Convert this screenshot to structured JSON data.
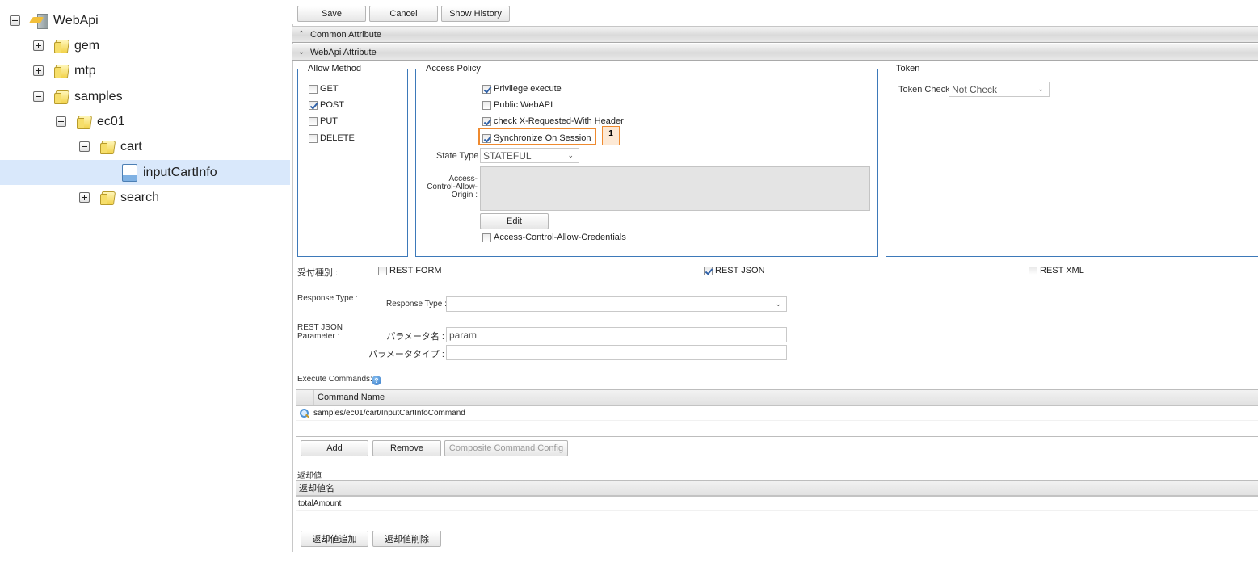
{
  "tree": {
    "nodes": [
      {
        "label": "WebApi",
        "type": "webapi",
        "toggle": "minus"
      },
      {
        "label": "gem",
        "type": "folder",
        "toggle": "plus"
      },
      {
        "label": "mtp",
        "type": "folder",
        "toggle": "plus"
      },
      {
        "label": "samples",
        "type": "folder",
        "toggle": "minus"
      },
      {
        "label": "ec01",
        "type": "folder",
        "toggle": "minus"
      },
      {
        "label": "cart",
        "type": "folder",
        "toggle": "minus"
      },
      {
        "label": "inputCartInfo",
        "type": "file",
        "selected": true
      },
      {
        "label": "search",
        "type": "folder",
        "toggle": "plus"
      }
    ]
  },
  "toolbar": {
    "save_label": "Save",
    "cancel_label": "Cancel",
    "show_history_label": "Show History"
  },
  "sections": {
    "common_attribute": "Common Attribute",
    "webapi_attribute": "WebApi Attribute"
  },
  "allow_method": {
    "legend": "Allow Method",
    "items": [
      {
        "label": "GET",
        "checked": false
      },
      {
        "label": "POST",
        "checked": true
      },
      {
        "label": "PUT",
        "checked": false
      },
      {
        "label": "DELETE",
        "checked": false
      }
    ]
  },
  "access_policy": {
    "legend": "Access Policy",
    "privilege_execute": {
      "label": "Privilege execute",
      "checked": true
    },
    "public_webapi": {
      "label": "Public WebAPI",
      "checked": false
    },
    "check_x_requested": {
      "label": "check X-Requested-With Header",
      "checked": true
    },
    "synchronize_on_session": {
      "label": "Synchronize On Session",
      "checked": true
    },
    "state_type_label": "State Type :",
    "state_type_value": "STATEFUL",
    "acao_label_1": "Access-",
    "acao_label_2": "Control-Allow-",
    "acao_label_3": "Origin :",
    "acao_value": "",
    "edit_label": "Edit",
    "allow_credentials": {
      "label": "Access-Control-Allow-Credentials",
      "checked": false
    }
  },
  "annotation": {
    "badge_label": "1",
    "highlight_color": "#ef8a2f"
  },
  "token": {
    "legend": "Token",
    "token_check_label": "Token Check :",
    "token_check_value": "Not Check"
  },
  "accept_type": {
    "label": "受付種別 :",
    "rest_form": {
      "label": "REST FORM",
      "checked": false
    },
    "rest_json": {
      "label": "REST JSON",
      "checked": true
    },
    "rest_xml": {
      "label": "REST XML",
      "checked": false
    }
  },
  "response_type": {
    "section_label": "Response Type :",
    "field_label": "Response Type :",
    "value": ""
  },
  "rest_json_parameter": {
    "section_label_1": "REST JSON",
    "section_label_2": "Parameter :",
    "param_name_label": "パラメータ名 :",
    "param_name_value": "param",
    "param_type_label": "パラメータタイプ :",
    "param_type_value": ""
  },
  "execute_commands": {
    "label": "Execute Commands:",
    "help_icon": "?",
    "column_header": "Command Name",
    "rows": [
      "samples/ec01/cart/InputCartInfoCommand"
    ],
    "add_label": "Add",
    "remove_label": "Remove",
    "composite_label": "Composite Command Config"
  },
  "return_values": {
    "label": "返却値",
    "column_header": "返却値名",
    "rows": [
      "totalAmount"
    ],
    "add_label": "返却値追加",
    "remove_label": "返却値削除"
  },
  "colors": {
    "accent_border": "#3d79b9",
    "tree_selected": "#d9e8fb",
    "check_color": "#3162a8"
  }
}
